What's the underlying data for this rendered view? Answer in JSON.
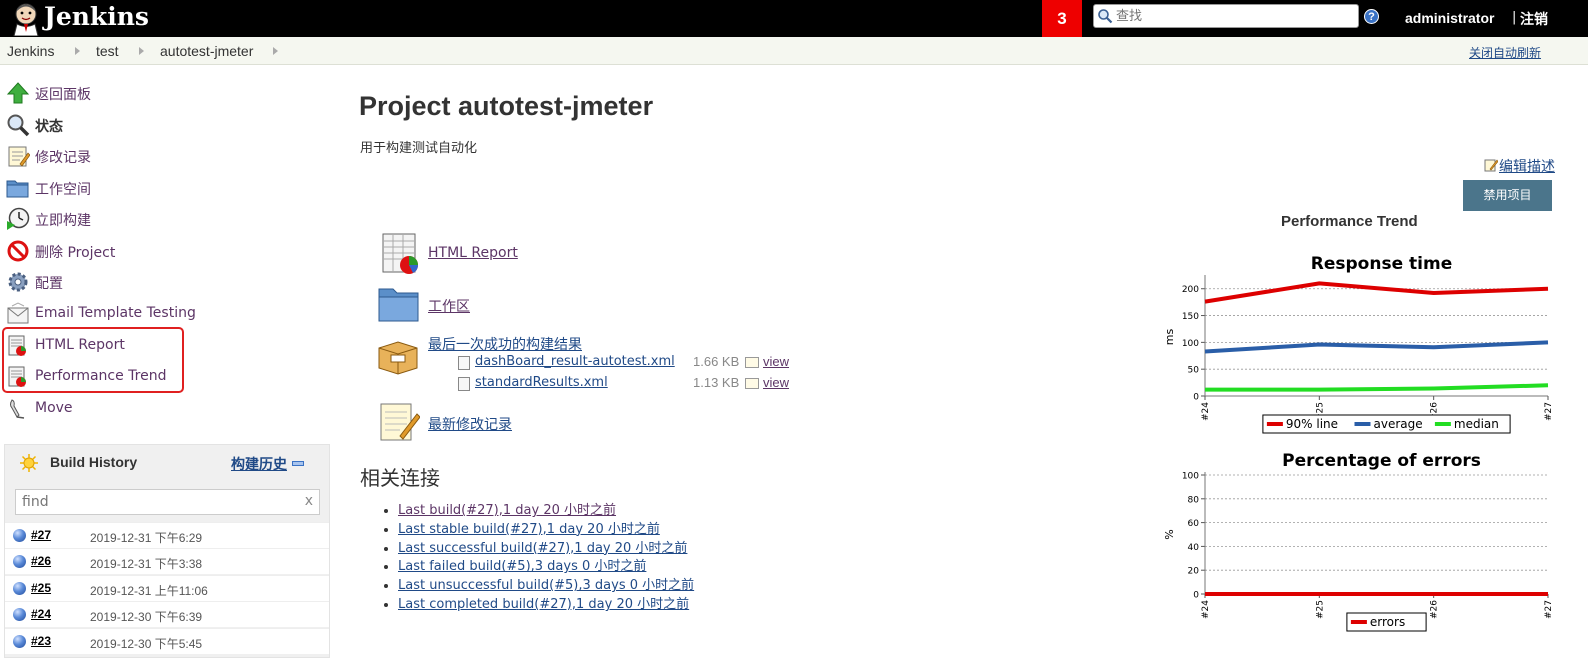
{
  "header": {
    "logo_text": "Jenkins",
    "badge": "3",
    "search_placeholder": "查找",
    "help": "?",
    "user": "administrator",
    "logout_sep": "|",
    "logout": "注销"
  },
  "breadcrumb": {
    "items": [
      "Jenkins",
      "test",
      "autotest-jmeter"
    ],
    "auto_refresh": "关闭自动刷新"
  },
  "sidebar": {
    "tasks": [
      {
        "label": "返回面板",
        "icon": "up-arrow-icon"
      },
      {
        "label": "状态",
        "icon": "magnifier-icon"
      },
      {
        "label": "修改记录",
        "icon": "notepad-icon"
      },
      {
        "label": "工作空间",
        "icon": "folder-icon"
      },
      {
        "label": "立即构建",
        "icon": "clock-icon"
      },
      {
        "label": "删除 Project",
        "icon": "no-entry-icon"
      },
      {
        "label": "配置",
        "icon": "gear-icon"
      },
      {
        "label": "Email Template Testing",
        "icon": "envelope-icon"
      },
      {
        "label": "HTML Report",
        "icon": "report-icon"
      },
      {
        "label": "Performance Trend",
        "icon": "report-icon"
      },
      {
        "label": "Move",
        "icon": "move-icon"
      }
    ]
  },
  "build_history": {
    "title": "Build History",
    "trend_label": "构建历史",
    "find_placeholder": "find",
    "clear": "x",
    "builds": [
      {
        "num": "#27",
        "date": "2019-12-31 下午6:29"
      },
      {
        "num": "#26",
        "date": "2019-12-31 下午3:38"
      },
      {
        "num": "#25",
        "date": "2019-12-31 上午11:06"
      },
      {
        "num": "#24",
        "date": "2019-12-30 下午6:39"
      },
      {
        "num": "#23",
        "date": "2019-12-30 下午5:45"
      }
    ]
  },
  "main": {
    "title": "Project autotest-jmeter",
    "description": "用于构建测试自动化",
    "edit_description": "编辑描述",
    "disable_button": "禁用项目",
    "links": {
      "html_report": "HTML Report",
      "workspace": "工作区",
      "last_success": "最后一次成功的构建结果",
      "changes": "最新修改记录"
    },
    "artifacts": [
      {
        "name": "dashBoard_result-autotest.xml",
        "size": "1.66 KB",
        "view": "view"
      },
      {
        "name": "standardResults.xml",
        "size": "1.13 KB",
        "view": "view"
      }
    ],
    "related_title": "相关连接",
    "related": [
      "Last build(#27),1 day 20 小时之前",
      "Last stable build(#27),1 day 20 小时之前",
      "Last successful build(#27),1 day 20 小时之前",
      "Last failed build(#5),3 days 0 小时之前",
      "Last unsuccessful build(#5),3 days 0 小时之前",
      "Last completed build(#27),1 day 20 小时之前"
    ]
  },
  "perf_title": "Performance Trend",
  "chart_data": [
    {
      "type": "line",
      "title": "Response time",
      "ylabel": "ms",
      "x": [
        "#24",
        "#25",
        "#26",
        "#27"
      ],
      "ylim": [
        0,
        220
      ],
      "yticks": [
        0,
        50,
        100,
        150,
        200
      ],
      "series": [
        {
          "name": "90% line",
          "color": "#dd0000",
          "values": [
            176,
            210,
            192,
            200
          ]
        },
        {
          "name": "average",
          "color": "#2a5ea8",
          "values": [
            83,
            96,
            91,
            100
          ]
        },
        {
          "name": "median",
          "color": "#22dd22",
          "values": [
            12,
            12,
            14,
            20
          ]
        }
      ],
      "grid": true,
      "legend": "bottom"
    },
    {
      "type": "line",
      "title": "Percentage of errors",
      "ylabel": "%",
      "x": [
        "#24",
        "#25",
        "#26",
        "#27"
      ],
      "ylim": [
        0,
        100
      ],
      "yticks": [
        0,
        20,
        40,
        60,
        80,
        100
      ],
      "series": [
        {
          "name": "errors",
          "color": "#dd0000",
          "values": [
            0,
            0,
            0,
            0
          ]
        }
      ],
      "grid": true,
      "legend": "bottom"
    }
  ]
}
